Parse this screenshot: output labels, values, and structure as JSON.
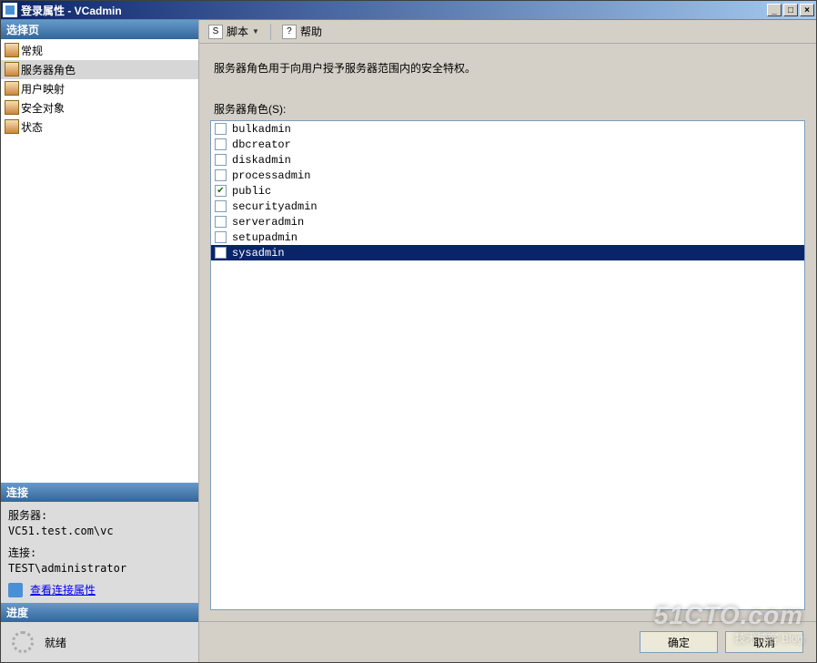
{
  "window": {
    "title": "登录属性 - VCadmin"
  },
  "sidebar": {
    "selectPageHeader": "选择页",
    "pages": [
      {
        "label": "常规",
        "selected": false
      },
      {
        "label": "服务器角色",
        "selected": true
      },
      {
        "label": "用户映射",
        "selected": false
      },
      {
        "label": "安全对象",
        "selected": false
      },
      {
        "label": "状态",
        "selected": false
      }
    ],
    "connectionHeader": "连接",
    "connection": {
      "serverLabel": "服务器:",
      "serverValue": "VC51.test.com\\vc",
      "connLabel": "连接:",
      "connValue": "TEST\\administrator",
      "viewLink": "查看连接属性"
    },
    "progressHeader": "进度",
    "progressStatus": "就绪"
  },
  "toolbar": {
    "scriptLabel": "脚本",
    "helpLabel": "帮助"
  },
  "main": {
    "description": "服务器角色用于向用户授予服务器范围内的安全特权。",
    "rolesLabel": "服务器角色(S):",
    "roles": [
      {
        "name": "bulkadmin",
        "checked": false,
        "selected": false
      },
      {
        "name": "dbcreator",
        "checked": false,
        "selected": false
      },
      {
        "name": "diskadmin",
        "checked": false,
        "selected": false
      },
      {
        "name": "processadmin",
        "checked": false,
        "selected": false
      },
      {
        "name": "public",
        "checked": true,
        "selected": false
      },
      {
        "name": "securityadmin",
        "checked": false,
        "selected": false
      },
      {
        "name": "serveradmin",
        "checked": false,
        "selected": false
      },
      {
        "name": "setupadmin",
        "checked": false,
        "selected": false
      },
      {
        "name": "sysadmin",
        "checked": false,
        "selected": true
      }
    ]
  },
  "buttons": {
    "ok": "确定",
    "cancel": "取消"
  },
  "watermark": {
    "line1": "51CTO.com",
    "line2": "技术博客  Blog"
  }
}
